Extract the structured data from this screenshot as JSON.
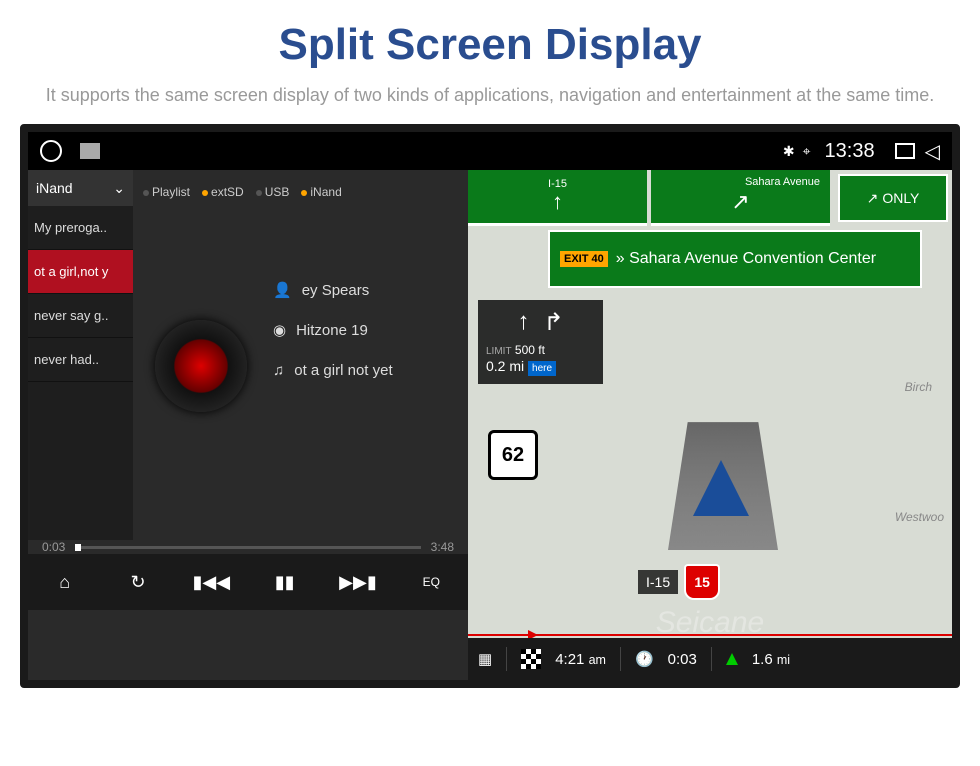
{
  "header": {
    "title": "Split Screen Display",
    "subtitle": "It supports the same screen display of two kinds of applications, navigation and entertainment at the same time."
  },
  "statusbar": {
    "time": "13:38"
  },
  "media": {
    "source_selected": "iNand",
    "sources": [
      "Playlist",
      "extSD",
      "USB",
      "iNand"
    ],
    "playlist": [
      "My preroga..",
      "ot a girl,not y",
      "never say g..",
      "never had.."
    ],
    "playlist_active_index": 1,
    "artist": "ey Spears",
    "album": "Hitzone 19",
    "track": "ot a girl not yet",
    "time_elapsed": "0:03",
    "time_total": "3:48",
    "eq_label": "EQ"
  },
  "nav": {
    "top_road": "I-15",
    "top_street": "Sahara Avenue",
    "only_label": "ONLY",
    "exit_badge": "EXIT 40",
    "exit_dest": "» Sahara Avenue Convention Center",
    "lane_dist_ft": "500 ft",
    "lane_limit_label": "LIMIT",
    "lane_dist_mi": "0.2",
    "lane_unit": "mi",
    "here_label": "here",
    "speed_limit": "62",
    "shield_route": "I-15",
    "shield_num": "15",
    "street_birch": "Birch",
    "street_west": "Westwoo",
    "arrival_time": "4:21",
    "arrival_ampm": "am",
    "eta_remaining": "0:03",
    "next_dist": "1.6",
    "next_unit": "mi"
  },
  "watermark": "Seicane"
}
